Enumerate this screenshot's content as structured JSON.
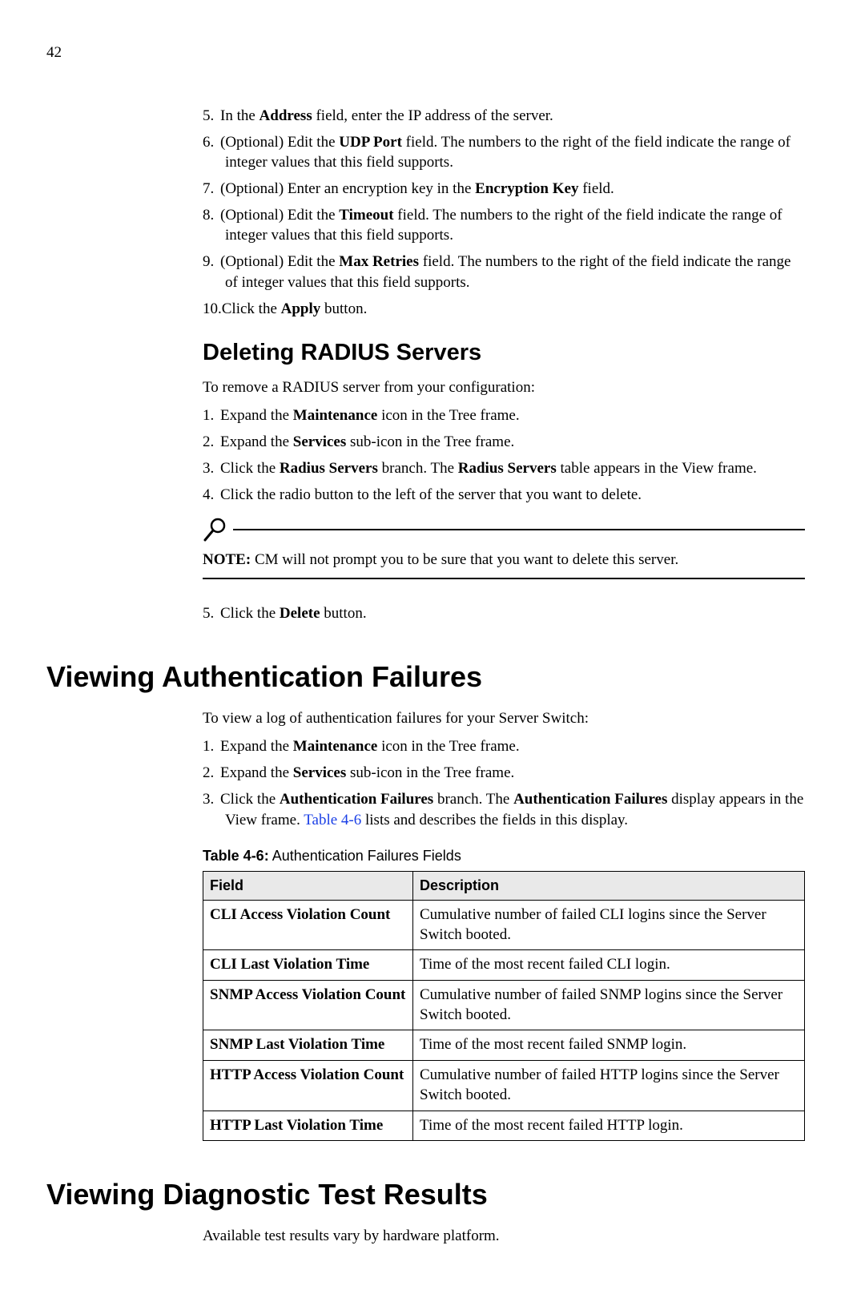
{
  "page_number": "42",
  "steps_top": [
    {
      "n": "5.",
      "pre": "In the ",
      "bold": "Address",
      "post": " field, enter the IP address of the server."
    },
    {
      "n": "6.",
      "pre": "(Optional) Edit the ",
      "bold": "UDP Port",
      "post": " field. The numbers to the right of the field indicate the range of integer values that this field supports."
    },
    {
      "n": "7.",
      "pre": "(Optional) Enter an encryption key in the ",
      "bold": "Encryption Key",
      "post": " field."
    },
    {
      "n": "8.",
      "pre": "(Optional) Edit the ",
      "bold": "Timeout",
      "post": " field. The numbers to the right of the field indicate the range of integer values that this field supports."
    },
    {
      "n": "9.",
      "pre": "(Optional) Edit the ",
      "bold": "Max Retries",
      "post": " field. The numbers to the right of the field indicate the range of integer values that this field supports."
    },
    {
      "n": "10.",
      "pre": "Click the ",
      "bold": "Apply",
      "post": " button."
    }
  ],
  "section_delete": {
    "heading": "Deleting RADIUS Servers",
    "intro": "To remove a RADIUS server from your configuration:",
    "steps_a": [
      {
        "n": "1.",
        "pre": "Expand the ",
        "bold": "Maintenance",
        "post": " icon in the Tree frame."
      },
      {
        "n": "2.",
        "pre": "Expand the ",
        "bold": "Services",
        "post": " sub-icon in the Tree frame."
      },
      {
        "n": "3.",
        "pre": "Click the ",
        "bold": "Radius Servers",
        "post": " branch. The ",
        "bold2": "Radius Servers",
        "post2": " table appears in the View frame."
      },
      {
        "n": "4.",
        "pre": "Click the radio button to the left of the server that you want to delete.",
        "bold": "",
        "post": ""
      }
    ],
    "note_label": "NOTE:",
    "note_text": "  CM will not prompt you to be sure that you want to delete this server.",
    "steps_b": [
      {
        "n": "5.",
        "pre": "Click the ",
        "bold": "Delete",
        "post": " button."
      }
    ]
  },
  "section_auth": {
    "heading": "Viewing Authentication Failures",
    "intro": "To view a log of authentication failures for your Server Switch:",
    "steps": [
      {
        "n": "1.",
        "pre": "Expand the ",
        "bold": "Maintenance",
        "post": " icon in the Tree frame."
      },
      {
        "n": "2.",
        "pre": "Expand the ",
        "bold": "Services",
        "post": " sub-icon in the Tree frame."
      },
      {
        "n": "3.",
        "pre": "Click the ",
        "bold": "Authentication Failures",
        "post": " branch. The ",
        "bold2": "Authentication Failures",
        "post2": " display appears in the View frame. ",
        "link": "Table 4-6",
        "post3": " lists and describes the fields in this display."
      }
    ],
    "table_caption_bold": "Table 4-6:",
    "table_caption_rest": " Authentication Failures Fields",
    "table_headers": {
      "field": "Field",
      "desc": "Description"
    },
    "rows": [
      {
        "field": "CLI Access Violation Count",
        "desc": "Cumulative number of failed CLI logins since the Server Switch booted."
      },
      {
        "field": "CLI Last Violation Time",
        "desc": "Time of the most recent failed CLI login."
      },
      {
        "field": "SNMP Access Violation Count",
        "desc": "Cumulative number of failed SNMP logins since the Server Switch booted."
      },
      {
        "field": "SNMP Last Violation Time",
        "desc": "Time of the most recent failed SNMP login."
      },
      {
        "field": "HTTP Access Violation Count",
        "desc": "Cumulative number of failed HTTP logins since the Server Switch booted."
      },
      {
        "field": "HTTP Last Violation Time",
        "desc": "Time of the most recent failed HTTP login."
      }
    ]
  },
  "section_diag": {
    "heading": "Viewing Diagnostic Test Results",
    "intro": "Available test results vary by hardware platform."
  }
}
